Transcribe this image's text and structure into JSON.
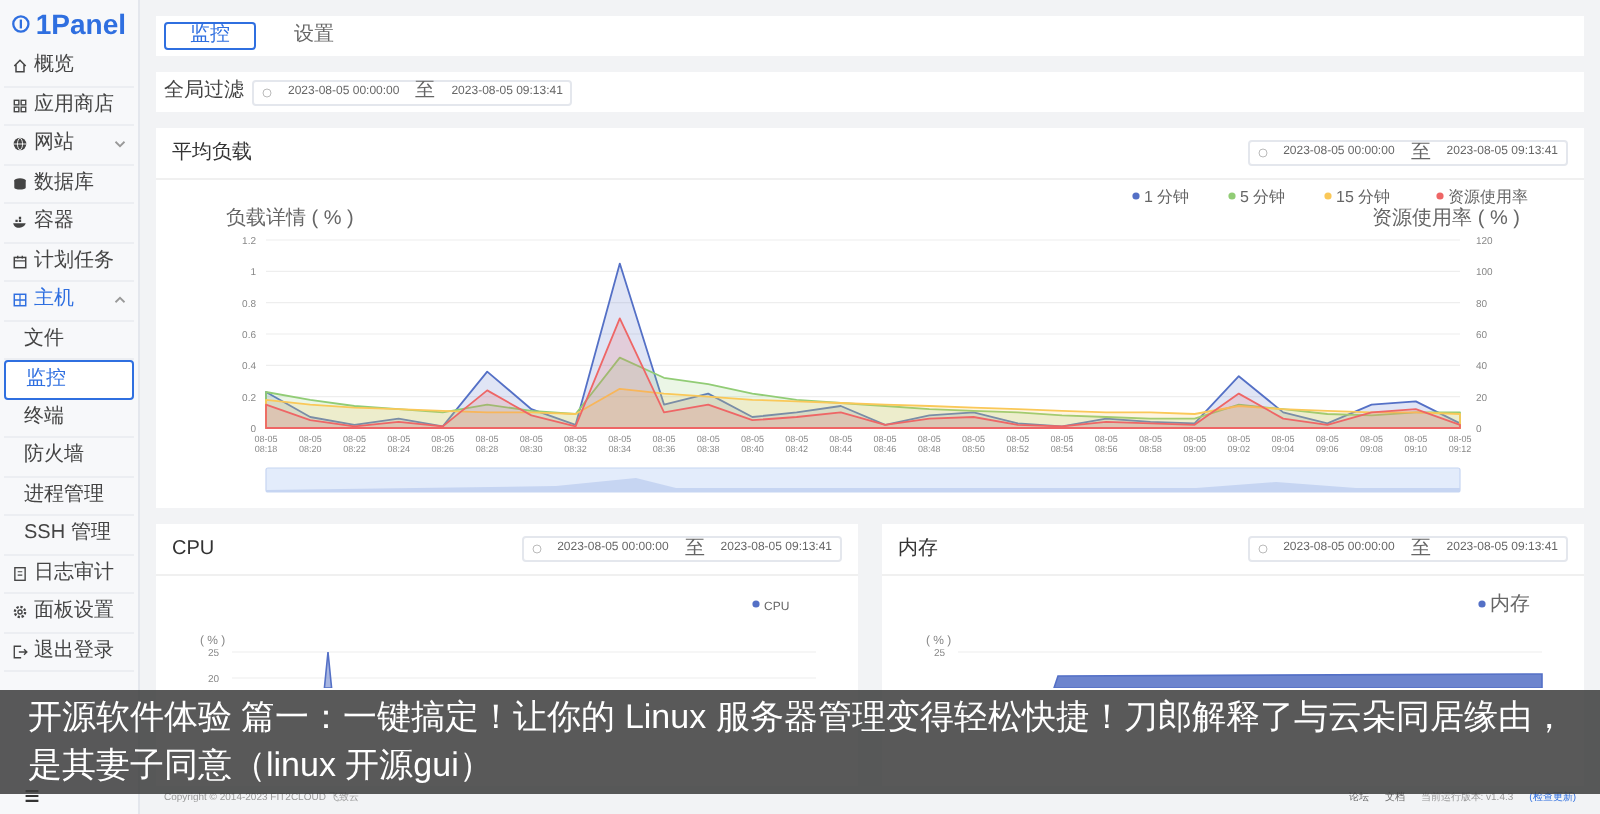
{
  "sidebar": {
    "logo": "1Panel",
    "items": [
      {
        "label": "概览",
        "selected": false
      },
      {
        "label": "应用商店",
        "selected": false
      },
      {
        "label": "网站",
        "selected": false,
        "expanded": false
      },
      {
        "label": "数据库",
        "selected": false
      },
      {
        "label": "容器",
        "selected": false
      },
      {
        "label": "计划任务",
        "selected": false
      },
      {
        "label": "主机",
        "selected": true,
        "expanded": true,
        "children": [
          {
            "label": "文件",
            "selected": false
          },
          {
            "label": "监控",
            "selected": true
          },
          {
            "label": "终端",
            "selected": false
          },
          {
            "label": "防火墙",
            "selected": false
          },
          {
            "label": "进程管理",
            "selected": false
          },
          {
            "label": "SSH 管理",
            "selected": false
          }
        ]
      },
      {
        "label": "日志审计",
        "selected": false
      },
      {
        "label": "面板设置",
        "selected": false
      },
      {
        "label": "退出登录",
        "selected": false
      }
    ]
  },
  "tabs": [
    {
      "label": "监控",
      "selected": true
    },
    {
      "label": "设置",
      "selected": false
    }
  ],
  "global_filter": {
    "label": "全局过滤",
    "start": "2023-08-05 00:00:00",
    "separator": "至",
    "end": "2023-08-05 09:13:41"
  },
  "load_panel": {
    "title": "平均负载",
    "range": {
      "start": "2023-08-05 00:00:00",
      "separator": "至",
      "end": "2023-08-05 09:13:41"
    },
    "right_axis": {
      "label": "资源使用率 ( % )",
      "ticks": [
        "120",
        "100",
        "80",
        "60",
        "40",
        "20",
        "0"
      ]
    },
    "chart_data": {
      "type": "area",
      "grid": true,
      "legend": true,
      "ylabel": "负载详情 ( % )",
      "ylim": [
        0,
        1.2
      ],
      "yticks": [
        0,
        0.2,
        0.4,
        0.6,
        0.8,
        1,
        1.2
      ],
      "categories": [
        "08-05 08:18",
        "08-05 08:20",
        "08-05 08:22",
        "08-05 08:24",
        "08-05 08:26",
        "08-05 08:28",
        "08-05 08:30",
        "08-05 08:32",
        "08-05 08:34",
        "08-05 08:36",
        "08-05 08:38",
        "08-05 08:40",
        "08-05 08:42",
        "08-05 08:44",
        "08-05 08:46",
        "08-05 08:48",
        "08-05 08:50",
        "08-05 08:52",
        "08-05 08:54",
        "08-05 08:56",
        "08-05 08:58",
        "08-05 09:00",
        "08-05 09:02",
        "08-05 09:04",
        "08-05 09:06",
        "08-05 09:08",
        "08-05 09:10",
        "08-05 09:12"
      ],
      "series": [
        {
          "name": "1 分钟",
          "color": "#5470c6",
          "values": [
            0.23,
            0.07,
            0.02,
            0.06,
            0.01,
            0.36,
            0.12,
            0.02,
            1.05,
            0.15,
            0.22,
            0.07,
            0.1,
            0.14,
            0.02,
            0.08,
            0.1,
            0.03,
            0.01,
            0.06,
            0.04,
            0.03,
            0.33,
            0.1,
            0.03,
            0.15,
            0.17,
            0.03
          ]
        },
        {
          "name": "5 分钟",
          "color": "#91cc75",
          "values": [
            0.23,
            0.18,
            0.14,
            0.12,
            0.1,
            0.15,
            0.11,
            0.09,
            0.45,
            0.32,
            0.28,
            0.22,
            0.18,
            0.16,
            0.14,
            0.12,
            0.11,
            0.1,
            0.08,
            0.07,
            0.06,
            0.06,
            0.15,
            0.12,
            0.09,
            0.08,
            0.1,
            0.1
          ]
        },
        {
          "name": "15 分钟",
          "color": "#fac858",
          "values": [
            0.18,
            0.15,
            0.13,
            0.12,
            0.11,
            0.1,
            0.1,
            0.09,
            0.25,
            0.22,
            0.2,
            0.18,
            0.17,
            0.16,
            0.15,
            0.14,
            0.13,
            0.12,
            0.11,
            0.1,
            0.1,
            0.09,
            0.14,
            0.12,
            0.11,
            0.1,
            0.1,
            0.09
          ]
        },
        {
          "name": "资源使用率",
          "color": "#ee6666",
          "values": [
            0.15,
            0.05,
            0.01,
            0.04,
            0.01,
            0.24,
            0.08,
            0.01,
            0.7,
            0.1,
            0.15,
            0.05,
            0.07,
            0.1,
            0.02,
            0.06,
            0.07,
            0.02,
            0.01,
            0.04,
            0.03,
            0.02,
            0.22,
            0.06,
            0.02,
            0.1,
            0.12,
            0.02
          ]
        }
      ]
    }
  },
  "cpu_panel": {
    "title": "CPU",
    "range": {
      "start": "2023-08-05 00:00:00",
      "separator": "至",
      "end": "2023-08-05 09:13:41"
    },
    "legend": "CPU",
    "ylabel": "( % )",
    "yticks": [
      "25",
      "20"
    ]
  },
  "memory_panel": {
    "title": "内存",
    "range": {
      "start": "2023-08-05 00:00:00",
      "separator": "至",
      "end": "2023-08-05 09:13:41"
    },
    "legend": "内存",
    "ylabel": "( % )",
    "yticks": [
      "25"
    ]
  },
  "footer": {
    "copyright": "Copyright © 2014-2023 FIT2CLOUD 飞致云",
    "links": [
      "论坛",
      "文档"
    ],
    "version": "当前运行版本: v1.4.3",
    "update": "(检查更新)"
  },
  "caption": "开源软件体验 篇一：一键搞定！让你的 Linux 服务器管理变得轻松快捷！刀郎解释了与云朵同居缘由，是其妻子同意（linux 开源gui）"
}
